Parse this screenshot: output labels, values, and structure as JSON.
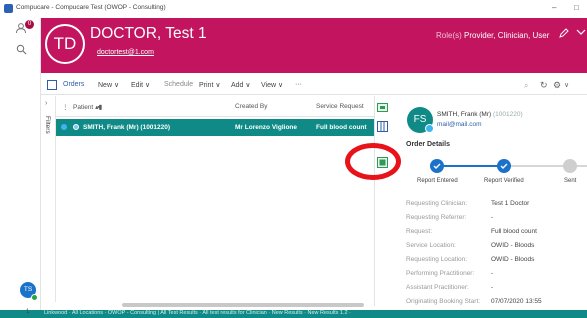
{
  "window": {
    "title": "Compucare - Compucare Test (OWOP - Consulting)",
    "controls": [
      "–",
      "□"
    ]
  },
  "rail": {
    "badge": "0",
    "user_initials": "TS"
  },
  "header": {
    "avatar_initials": "TD",
    "name": "DOCTOR, Test 1",
    "email": "doctortest@1.com",
    "roles_label": "Role(s)",
    "roles_value": "Provider, Clinician, User"
  },
  "toolbar": {
    "orders": "Orders",
    "new": "New",
    "edit": "Edit",
    "schedule": "Schedule",
    "print": "Print",
    "add": "Add",
    "view": "View",
    "more": "···"
  },
  "filters": {
    "label": "Filters",
    "arrow": "›"
  },
  "table": {
    "columns": [
      "Patient",
      "Created By",
      "Service Request"
    ],
    "rows": [
      {
        "patient": "SMITH, Frank (Mr) (1001220)",
        "created_by": "Mr Lorenzo Viglione",
        "service_request": "Full blood count"
      }
    ]
  },
  "detail": {
    "avatar_initials": "FS",
    "name": "SMITH, Frank (Mr)",
    "id": "(1001220)",
    "email": "mail@mail.com",
    "section_title": "Order Details",
    "steps": [
      "Report Entered",
      "Report Verified",
      "Sent"
    ],
    "fields": [
      {
        "k": "Requesting Clinician:",
        "v": "Test 1 Doctor"
      },
      {
        "k": "Requesting Referrer:",
        "v": "-"
      },
      {
        "k": "Request:",
        "v": "Full blood count"
      },
      {
        "k": "Service Location:",
        "v": "OWID - Bloods"
      },
      {
        "k": "Requesting Location:",
        "v": "OWID - Bloods"
      },
      {
        "k": "Performing Practitioner:",
        "v": "-"
      },
      {
        "k": "Assistant Practitioner:",
        "v": "-"
      },
      {
        "k": "Originating Booking Start:",
        "v": "07/07/2020 13:55"
      }
    ]
  },
  "statusbar": {
    "number": "1",
    "text": "Linkwood · All Locations · OWOP - Consulting | All Test Results · All test results for Clinician · New Results · New Results 1.2 ·"
  },
  "colors": {
    "header": "#c2145f",
    "selected_row": "#0f8a86",
    "accent": "#1b73c9",
    "annotation": "#e8121a"
  }
}
